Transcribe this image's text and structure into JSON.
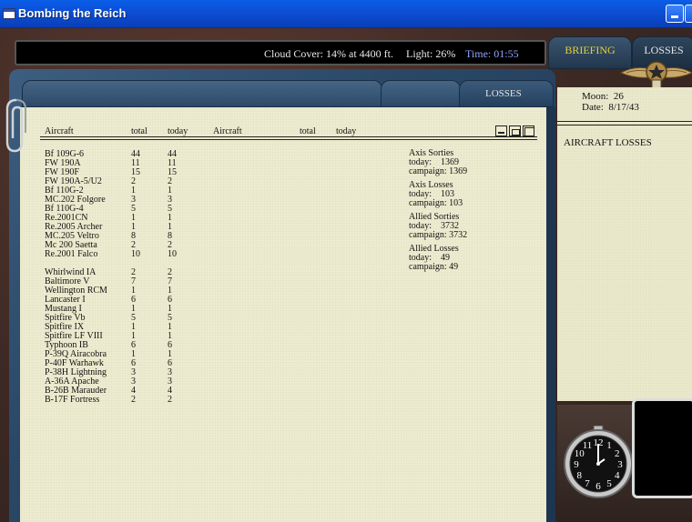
{
  "window": {
    "title": "Bombing the Reich"
  },
  "infobar": {
    "cloud_cover": "Cloud Cover: 14% at 4400 ft.",
    "light": "Light: 26%",
    "time": "Time: 01:55"
  },
  "tabs": {
    "briefing": "BRIEFING",
    "losses": "LOSSES",
    "folder_losses": "LOSSES"
  },
  "table": {
    "headers": {
      "aircraft": "Aircraft",
      "total": "total",
      "today": "today",
      "aircraft2": "Aircraft",
      "total2": "total",
      "today2": "today"
    },
    "axis": [
      {
        "name": "Bf 109G-6",
        "total": "44",
        "today": "44"
      },
      {
        "name": "FW 190A",
        "total": "11",
        "today": "11"
      },
      {
        "name": "FW 190F",
        "total": "15",
        "today": "15"
      },
      {
        "name": "FW 190A-5/U2",
        "total": "2",
        "today": "2"
      },
      {
        "name": "Bf 110G-2",
        "total": "1",
        "today": "1"
      },
      {
        "name": "MC.202 Folgore",
        "total": "3",
        "today": "3"
      },
      {
        "name": "Bf 110G-4",
        "total": "5",
        "today": "5"
      },
      {
        "name": "Re.2001CN",
        "total": "1",
        "today": "1"
      },
      {
        "name": "Re.2005 Archer",
        "total": "1",
        "today": "1"
      },
      {
        "name": "MC.205 Veltro",
        "total": "8",
        "today": "8"
      },
      {
        "name": "Mc 200 Saetta",
        "total": "2",
        "today": "2"
      },
      {
        "name": "Re.2001 Falco",
        "total": "10",
        "today": "10"
      }
    ],
    "allied": [
      {
        "name": "Whirlwind IA",
        "total": "2",
        "today": "2"
      },
      {
        "name": "Baltimore V",
        "total": "7",
        "today": "7"
      },
      {
        "name": "Wellington RCM",
        "total": "1",
        "today": "1"
      },
      {
        "name": "Lancaster I",
        "total": "6",
        "today": "6"
      },
      {
        "name": "Mustang I",
        "total": "1",
        "today": "1"
      },
      {
        "name": "Spitfire Vb",
        "total": "5",
        "today": "5"
      },
      {
        "name": "Spitfire IX",
        "total": "1",
        "today": "1"
      },
      {
        "name": "Spitfire LF VIII",
        "total": "1",
        "today": "1"
      },
      {
        "name": "Typhoon IB",
        "total": "6",
        "today": "6"
      },
      {
        "name": "P-39Q Airacobra",
        "total": "1",
        "today": "1"
      },
      {
        "name": "P-40F Warhawk",
        "total": "6",
        "today": "6"
      },
      {
        "name": "P-38H Lightning",
        "total": "3",
        "today": "3"
      },
      {
        "name": "A-36A Apache",
        "total": "3",
        "today": "3"
      },
      {
        "name": "B-26B Marauder",
        "total": "4",
        "today": "4"
      },
      {
        "name": "B-17F Fortress",
        "total": "2",
        "today": "2"
      }
    ]
  },
  "stats": {
    "axis_sorties": {
      "label": "Axis Sorties",
      "today": "today:    1369",
      "campaign": "campaign: 1369"
    },
    "axis_losses": {
      "label": "Axis Losses",
      "today": "today:    103",
      "campaign": "campaign: 103"
    },
    "allied_sorties": {
      "label": "Allied Sorties",
      "today": "today:    3732",
      "campaign": "campaign: 3732"
    },
    "allied_losses": {
      "label": "Allied Losses",
      "today": "today:    49",
      "campaign": "campaign: 49"
    }
  },
  "side_panel": {
    "moon": "Moon:  26",
    "date": "Date:  8/17/43",
    "header": "AIRCRAFT LOSSES"
  },
  "clock": {
    "numerals": [
      "12",
      "1",
      "2",
      "3",
      "4",
      "5",
      "6",
      "7",
      "8",
      "9",
      "10",
      "11"
    ]
  }
}
